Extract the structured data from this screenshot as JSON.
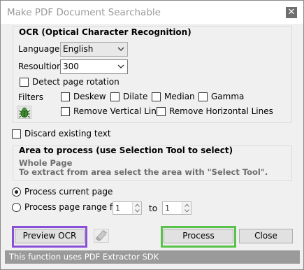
{
  "window": {
    "title": "Make PDF Document Searchable",
    "close_glyph": "✕"
  },
  "ocr": {
    "group_title": "OCR (Optical Character Recognition)",
    "language_label": "Language",
    "language_value": "English",
    "resolution_label": "Resoultion",
    "resolution_value": "300",
    "detect_rotation_label": "Detect page rotation",
    "filters_label": "Filters",
    "filters": {
      "deskew": "Deskew",
      "dilate": "Dilate",
      "median": "Median",
      "gamma": "Gamma",
      "remove_vertical": "Remove Vertical Lines",
      "remove_horizontal": "Remove Horizontal Lines"
    },
    "filter_icon": "bug-icon"
  },
  "discard_label": "Discard existing text",
  "area": {
    "group_title": "Area to process (use Selection Tool to select)",
    "line1": "Whole Page",
    "line2": "To extract from area select the area with \"Select Tool\"."
  },
  "range": {
    "current_page_label": "Process current page",
    "current_page_selected": true,
    "page_range_label": "Process page range from",
    "from_value": "1",
    "to_label": "to",
    "to_value": "1"
  },
  "buttons": {
    "preview": "Preview OCR",
    "process": "Process",
    "close": "Close",
    "eraser_icon": "eraser-icon"
  },
  "status": "This function uses PDF Extractor SDK",
  "colors": {
    "preview_highlight": "#8a4fd8",
    "process_highlight": "#59c24a",
    "status_bg": "#9a9a9a"
  }
}
